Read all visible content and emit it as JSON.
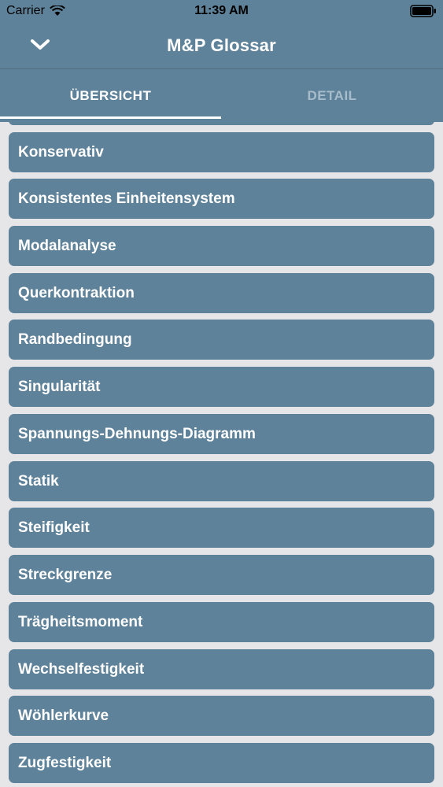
{
  "status_bar": {
    "carrier": "Carrier",
    "time": "11:39 AM",
    "wifi_icon": "wifi-icon",
    "battery_icon": "battery-icon"
  },
  "navbar": {
    "title": "M&P Glossar",
    "back_icon": "chevron-down-icon"
  },
  "tabs": [
    {
      "label": "ÜBERSICHT",
      "active": true
    },
    {
      "label": "DETAIL",
      "active": false
    }
  ],
  "glossary": {
    "items": [
      "Konservativ",
      "Konsistentes Einheitensystem",
      "Modalanalyse",
      "Querkontraktion",
      "Randbedingung",
      "Singularität",
      "Spannungs-Dehnungs-Diagramm",
      "Statik",
      "Steifigkeit",
      "Streckgrenze",
      "Trägheitsmoment",
      "Wechselfestigkeit",
      "Wöhlerkurve",
      "Zugfestigkeit"
    ]
  },
  "colors": {
    "header": "#5e8299",
    "item": "#5e8299",
    "background": "#e6e6e8",
    "inactive_tab": "#a7bccb"
  }
}
